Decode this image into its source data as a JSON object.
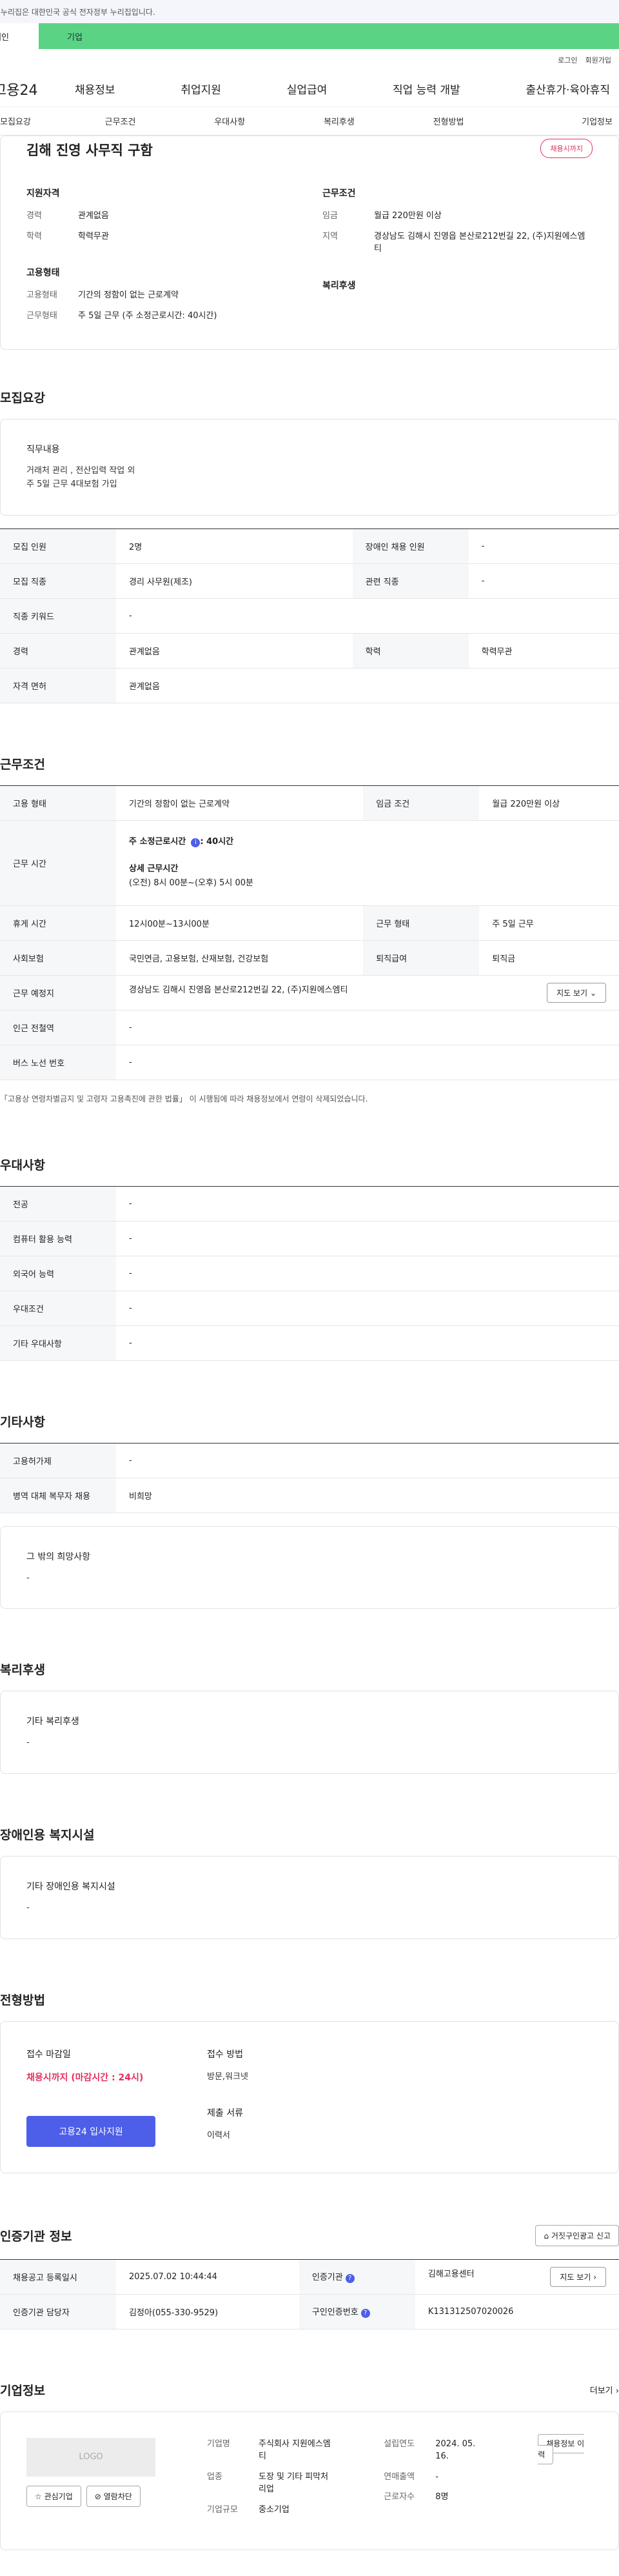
{
  "banner": "이 누리집은 대한민국 공식 전자정부 누리집입니다.",
  "top_tabs": {
    "individual": "개인",
    "corporate": "기업"
  },
  "util": {
    "login": "로그인",
    "signup": "회원가입"
  },
  "gnb": {
    "logo": "고용24",
    "items": [
      "채용정보",
      "취업지원",
      "실업급여",
      "직업 능력 개발",
      "출산휴가·육아휴직"
    ]
  },
  "subnav": [
    "모집요강",
    "근무조건",
    "우대사항",
    "복리후생",
    "전형방법",
    "기업정보"
  ],
  "summary": {
    "title": "김해 진영 사무직 구함",
    "badge": "채용시까지",
    "qual_h": "지원자격",
    "career_k": "경력",
    "career_v": "관계없음",
    "edu_k": "학력",
    "edu_v": "학력무관",
    "emp_h": "고용형태",
    "emptype_k": "고용형태",
    "emptype_v": "기간의 정함이 없는 근로계약",
    "workform_k": "근무형태",
    "workform_v": "주 5일 근무 (주 소정근로시간: 40시간)",
    "cond_h": "근무조건",
    "wage_k": "임금",
    "wage_v": "월급 220만원 이상",
    "region_k": "지역",
    "region_v": "경상남도 김해시 진영읍 본산로212번길 22, (주)지원에스엠티",
    "welfare_h": "복리후생"
  },
  "recruit": {
    "title": "모집요강",
    "duty_h": "직무내용",
    "duty_t1": "거래처 관리 , 전산입력 작업 외",
    "duty_t2": "주 5일 근무  4대보험 가입",
    "rows": [
      [
        "모집 인원",
        "2명",
        "장애인 채용 인원",
        "-"
      ],
      [
        "모집 직종",
        "경리 사무원(제조)",
        "관련 직종",
        "-"
      ],
      [
        "직종 키워드",
        "-",
        "",
        ""
      ],
      [
        "경력",
        "관계없음",
        "학력",
        "학력무관"
      ],
      [
        "자격 면허",
        "관계없음",
        "",
        ""
      ]
    ]
  },
  "work": {
    "title": "근무조건",
    "emptype_k": "고용 형태",
    "emptype_v": "기간의 정함이 없는 근로계약",
    "wage_k": "임금 조건",
    "wage_v": "월급 220만원 이상",
    "hours_k": "근무 시간",
    "hours_h1": "주 소정근로시간",
    "hours_h1v": ": 40시간",
    "hours_h2": "상세 근무시간",
    "hours_h2v": "(오전) 8시 00분~(오후) 5시 00분",
    "rest_k": "휴게 시간",
    "rest_v": "12시00분~13시00분",
    "form_k": "근무 형태",
    "form_v": "주 5일 근무",
    "ins_k": "사회보험",
    "ins_v": "국민연금, 고용보험, 산재보험, 건강보험",
    "ret_k": "퇴직급여",
    "ret_v": "퇴직금",
    "place_k": "근무 예정지",
    "place_v": "경상남도 김해시 진영읍 본산로212번길 22, (주)지원에스엠티",
    "map_btn": "지도 보기",
    "subway_k": "인근 전철역",
    "subway_v": "-",
    "bus_k": "버스 노선 번호",
    "bus_v": "-",
    "note": "「고용상 연령차별금지 및 고령자 고용촉진에 관한 법률」 이 시행됨에 따라 채용정보에서 연령이 삭제되었습니다."
  },
  "pref": {
    "title": "우대사항",
    "rows": [
      [
        "전공",
        "-"
      ],
      [
        "컴퓨터 활용 능력",
        "-"
      ],
      [
        "외국어 능력",
        "-"
      ],
      [
        "우대조건",
        "-"
      ],
      [
        "기타 우대사항",
        "-"
      ]
    ]
  },
  "etc": {
    "title": "기타사항",
    "rows": [
      [
        "고용허가제",
        "-"
      ],
      [
        "병역 대체 복무자 채용",
        "비희망"
      ]
    ],
    "wish_h": "그 밖의 희망사항",
    "wish_v": "-"
  },
  "welfare": {
    "title": "복리후생",
    "h": "기타 복리후생",
    "v": "-"
  },
  "disabled": {
    "title": "장애인용 복지시설",
    "h": "기타 장애인용 복지시설",
    "v": "-"
  },
  "select": {
    "title": "전형방법",
    "deadline_h": "접수 마감일",
    "deadline_v": "채용시까지 (마감시간 : 24시)",
    "apply_btn": "고용24 입사지원",
    "method_h": "접수 방법",
    "method_v": "방문,워크넷",
    "docs_h": "제출 서류",
    "docs_v": "이력서"
  },
  "agency": {
    "title": "인증기관 정보",
    "report_btn": "거짓구인광고 신고",
    "reg_k": "채용공고 등록일시",
    "reg_v": "2025.07.02 10:44:44",
    "org_k": "인증기관",
    "org_v": "김해고용센터",
    "map_btn": "지도 보기",
    "mgr_k": "인증기관 담당자",
    "mgr_v": "김정아(055-330-9529)",
    "num_k": "구인인증번호",
    "num_v": "K131312507020026"
  },
  "company": {
    "title": "기업정보",
    "more": "더보기",
    "logo": "LOGO",
    "like_btn": "관심기업",
    "block_btn": "열람차단",
    "name_k": "기업명",
    "name_v": "주식회사 지원에스엠티",
    "ind_k": "업종",
    "ind_v": "도장 및 기타 피막처리업",
    "size_k": "기업규모",
    "size_v": "중소기업",
    "found_k": "설립연도",
    "found_v": "2024. 05. 16.",
    "sales_k": "연매출액",
    "sales_v": "-",
    "emp_k": "근로자수",
    "emp_v": "8명",
    "history_btn": "채용정보 이력"
  }
}
